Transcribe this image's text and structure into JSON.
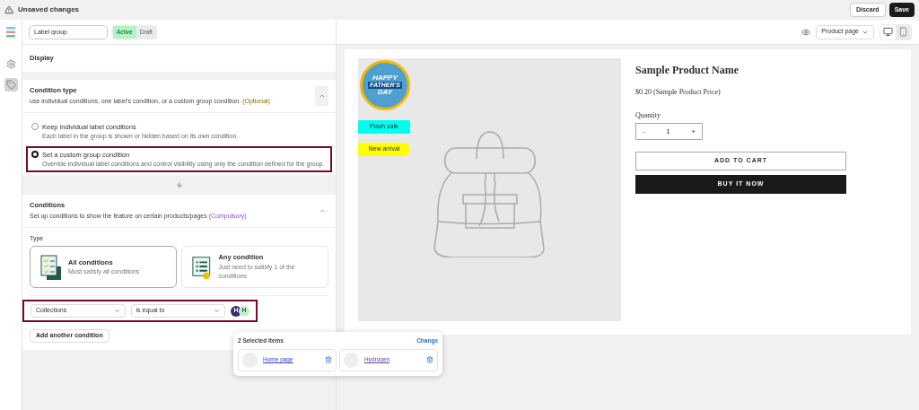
{
  "top_bar": {
    "title": "Unsaved changes",
    "buttons": [
      {
        "label": "Discard",
        "kind": "secondary"
      },
      {
        "label": "Save",
        "kind": "primary"
      }
    ]
  },
  "toolbar": {
    "name_value": "Label group",
    "status": [
      {
        "label": "Active",
        "selected": true
      },
      {
        "label": "Draft",
        "selected": false
      }
    ],
    "preview_page": "Product page",
    "devices": [
      {
        "kind": "desktop",
        "selected": true
      },
      {
        "kind": "mobile",
        "selected": false
      }
    ]
  },
  "sidebar": {
    "items": [
      {
        "kind": "settings",
        "selected": false
      },
      {
        "kind": "tag",
        "selected": true
      }
    ]
  },
  "display": {
    "title": "Display"
  },
  "condition_type": {
    "title": "Condition type",
    "description": "use individual conditions, one label's condition, or a custom group condition.",
    "note": "(Optional)",
    "expanded": true,
    "options": [
      {
        "label": "Keep individual label conditions",
        "description": "Each label in the group is shown or hidden based on its own condition.",
        "selected": false,
        "highlighted": false
      },
      {
        "label": "Set a custom group condition",
        "description": "Override individual label conditions and control visibility using only the condition defined for the group.",
        "selected": true,
        "highlighted": true
      }
    ]
  },
  "conditions": {
    "title": "Conditions",
    "description": "Set up conditions to show the feature on certain products/pages",
    "note": "(Compulsory)",
    "expanded": true,
    "type_label": "Type",
    "types": [
      {
        "kind": "all",
        "title": "All conditions",
        "description": "Must satisfy all conditions",
        "selected": true
      },
      {
        "kind": "any",
        "title": "Any condition",
        "description": "Just need to satisfy 1 of the conditions",
        "selected": false
      }
    ],
    "rule": {
      "field": "Collections",
      "operator": "is equal to",
      "highlighted": true,
      "avatars": [
        {
          "letter": "H",
          "color": "#3b2a7a"
        },
        {
          "letter": "H",
          "color": "#c8f0cf"
        }
      ]
    },
    "add_button": "Add another condition"
  },
  "popup": {
    "title": "2 Selected Items",
    "action": "Change",
    "items": [
      {
        "label": "Home page",
        "visited": false
      },
      {
        "label": "Hydrogen",
        "visited": true
      }
    ]
  },
  "preview": {
    "badge": {
      "lines": [
        "HAPPY",
        "FATHER'S",
        "DAY"
      ]
    },
    "labels": [
      {
        "text": "Flash sale",
        "kind": "rectangle",
        "color": "#00ffee"
      },
      {
        "text": "New arrival",
        "kind": "pill",
        "color": "#ffff00"
      }
    ],
    "product": {
      "name": "Sample Product Name",
      "price": "$0.20 (Sample Product Price)",
      "quantity_label": "Quantity",
      "minus": "-",
      "quantity": "1",
      "plus": "+",
      "buttons": [
        {
          "label": "ADD TO CART",
          "kind": "outline"
        },
        {
          "label": "BUY IT NOW",
          "kind": "solid"
        }
      ]
    }
  }
}
